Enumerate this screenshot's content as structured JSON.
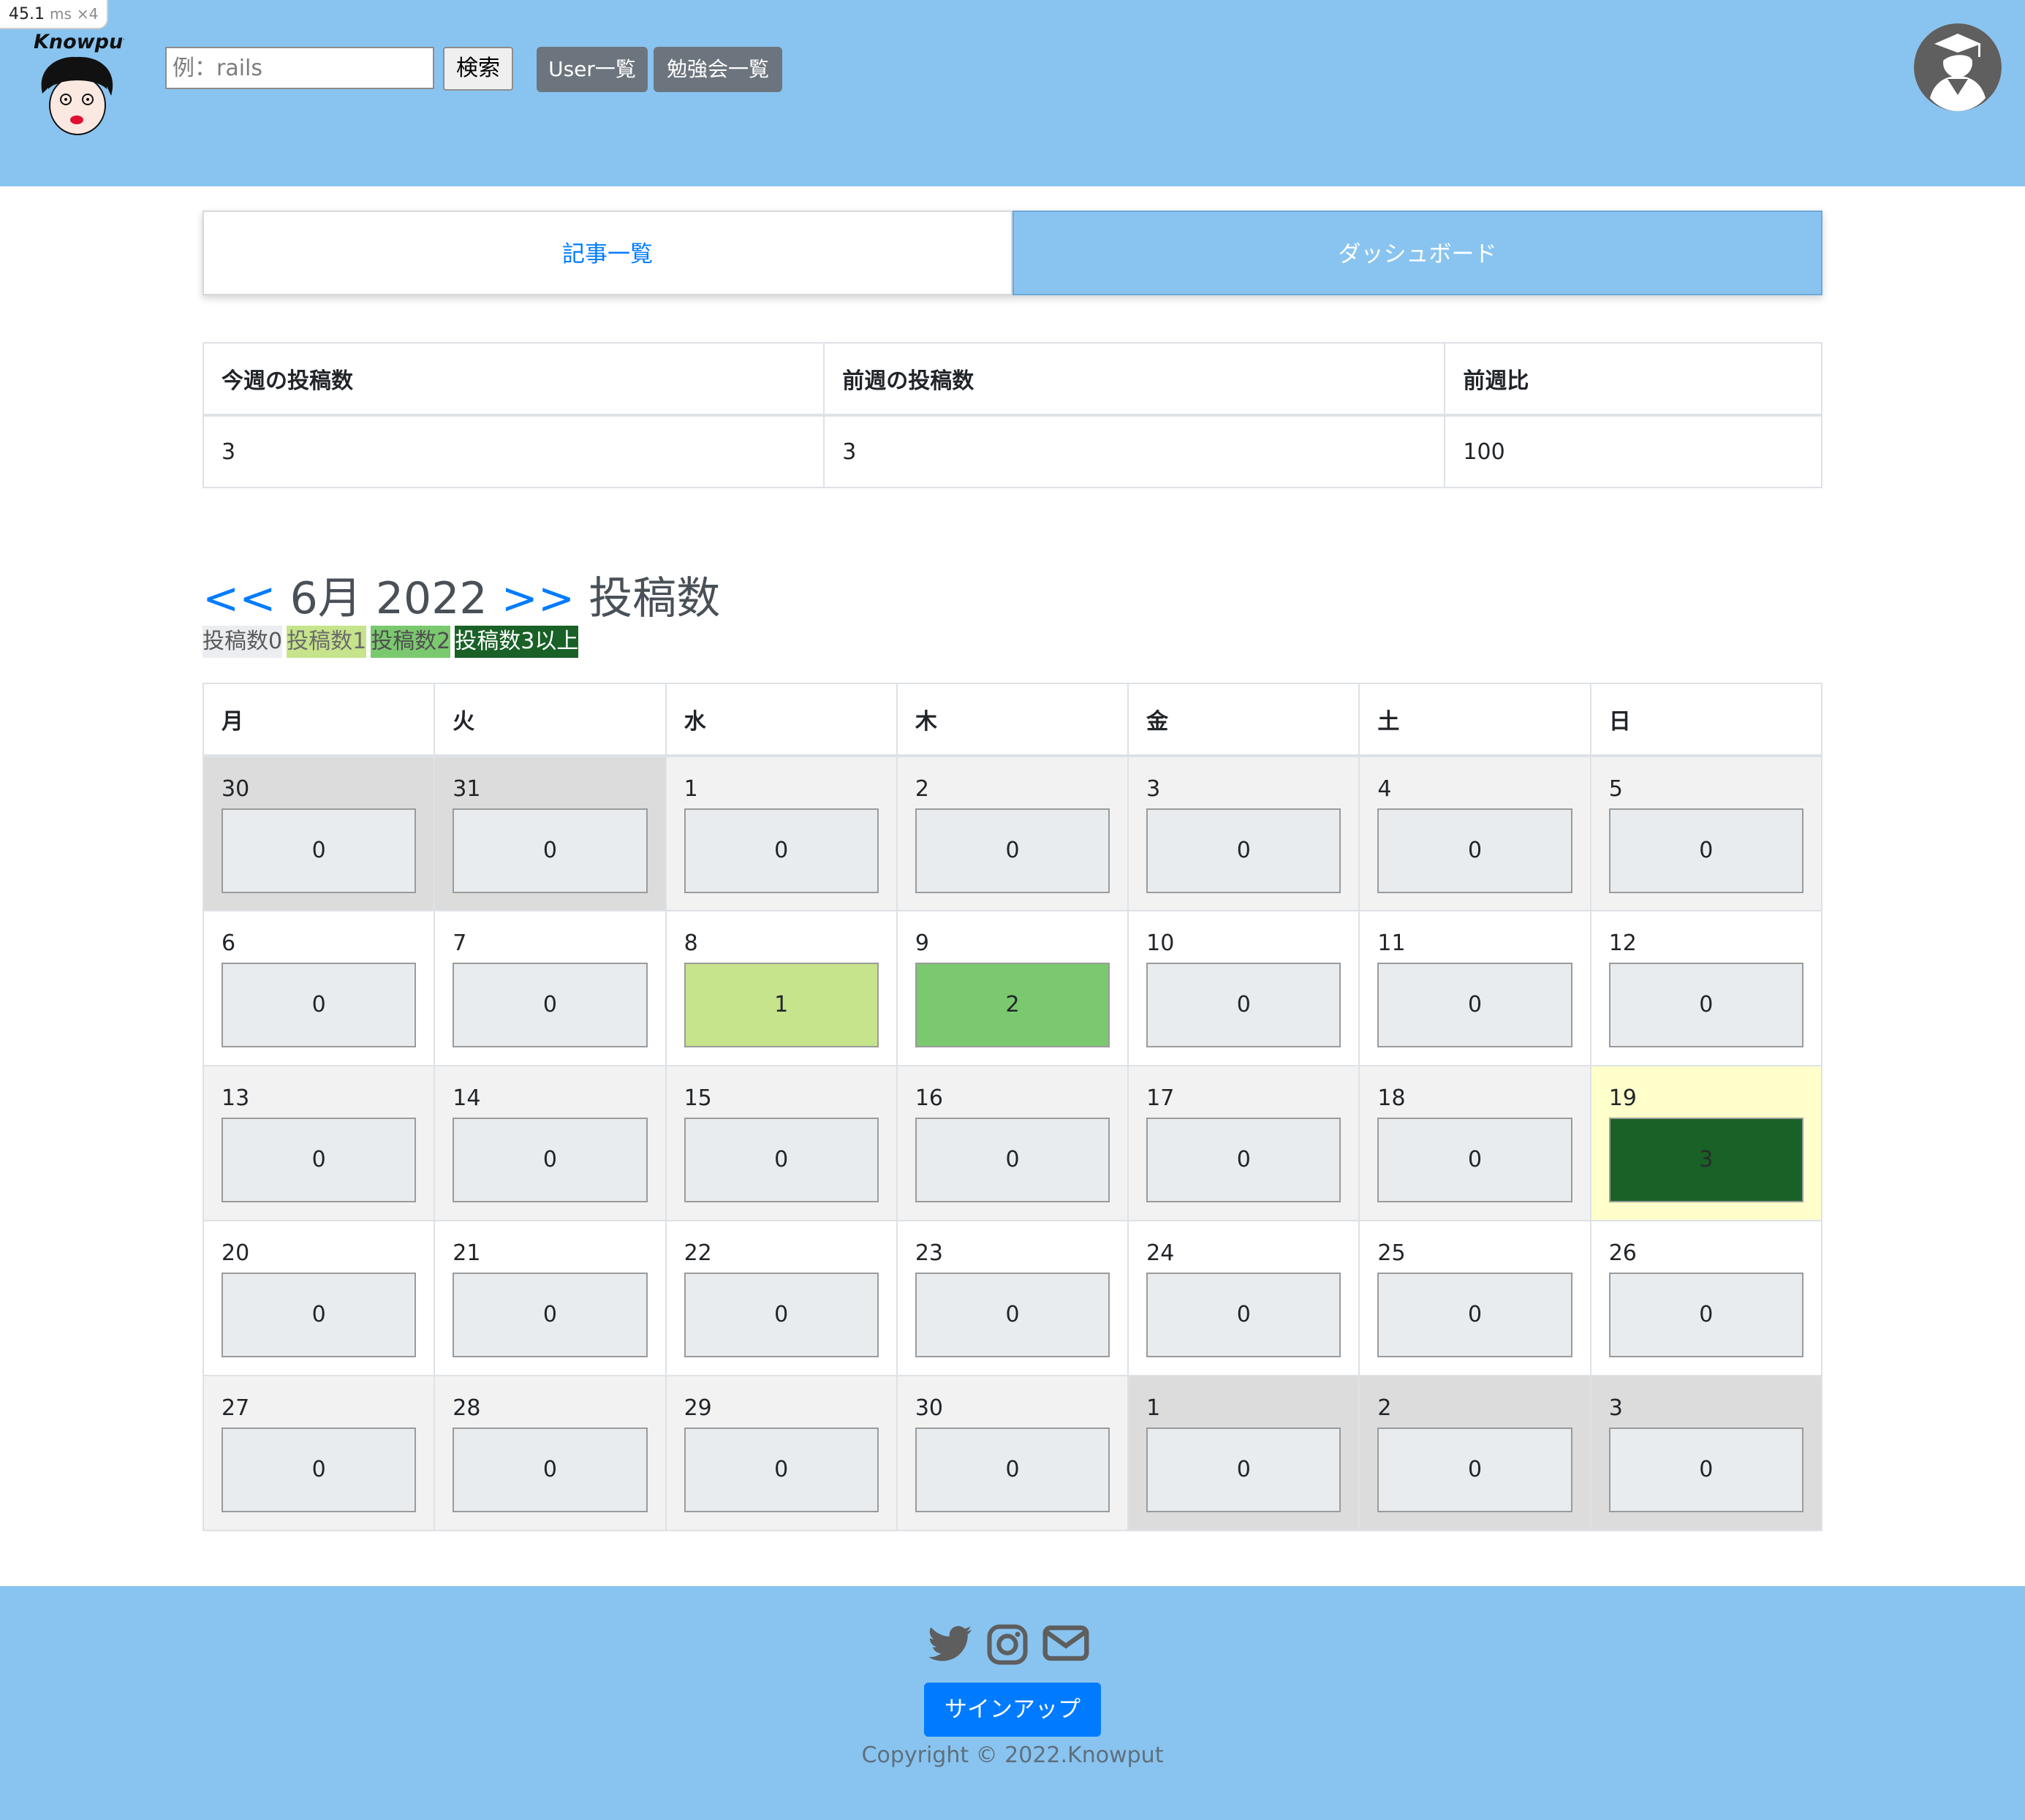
{
  "perf": {
    "value": "45.1",
    "unit": "ms",
    "mult": "×4"
  },
  "header": {
    "logo_text": "Knowput",
    "search_placeholder": "例：rails",
    "search_button": "検索",
    "nav": [
      "User一覧",
      "勉強会一覧"
    ]
  },
  "tabs": {
    "articles": "記事一覧",
    "dashboard": "ダッシュボード"
  },
  "stats": {
    "headers": [
      "今週の投稿数",
      "前週の投稿数",
      "前週比"
    ],
    "values": [
      "3",
      "3",
      "100"
    ]
  },
  "calendar": {
    "prev": "<<",
    "month": "6月 2022",
    "next": ">>",
    "label": "投稿数",
    "legend": [
      "投稿数0",
      "投稿数1",
      "投稿数2",
      "投稿数3以上"
    ],
    "weekdays": [
      "月",
      "火",
      "水",
      "木",
      "金",
      "土",
      "日"
    ],
    "weeks": [
      [
        {
          "d": "30",
          "c": "0",
          "o": true
        },
        {
          "d": "31",
          "c": "0",
          "o": true
        },
        {
          "d": "1",
          "c": "0"
        },
        {
          "d": "2",
          "c": "0"
        },
        {
          "d": "3",
          "c": "0"
        },
        {
          "d": "4",
          "c": "0"
        },
        {
          "d": "5",
          "c": "0"
        }
      ],
      [
        {
          "d": "6",
          "c": "0"
        },
        {
          "d": "7",
          "c": "0"
        },
        {
          "d": "8",
          "c": "1"
        },
        {
          "d": "9",
          "c": "2"
        },
        {
          "d": "10",
          "c": "0"
        },
        {
          "d": "11",
          "c": "0"
        },
        {
          "d": "12",
          "c": "0"
        }
      ],
      [
        {
          "d": "13",
          "c": "0"
        },
        {
          "d": "14",
          "c": "0"
        },
        {
          "d": "15",
          "c": "0"
        },
        {
          "d": "16",
          "c": "0"
        },
        {
          "d": "17",
          "c": "0"
        },
        {
          "d": "18",
          "c": "0"
        },
        {
          "d": "19",
          "c": "3",
          "t": true
        }
      ],
      [
        {
          "d": "20",
          "c": "0"
        },
        {
          "d": "21",
          "c": "0"
        },
        {
          "d": "22",
          "c": "0"
        },
        {
          "d": "23",
          "c": "0"
        },
        {
          "d": "24",
          "c": "0"
        },
        {
          "d": "25",
          "c": "0"
        },
        {
          "d": "26",
          "c": "0"
        }
      ],
      [
        {
          "d": "27",
          "c": "0"
        },
        {
          "d": "28",
          "c": "0"
        },
        {
          "d": "29",
          "c": "0"
        },
        {
          "d": "30",
          "c": "0"
        },
        {
          "d": "1",
          "c": "0",
          "o": true
        },
        {
          "d": "2",
          "c": "0",
          "o": true
        },
        {
          "d": "3",
          "c": "0",
          "o": true
        }
      ]
    ]
  },
  "footer": {
    "icons": [
      "twitter-icon",
      "instagram-icon",
      "mail-icon"
    ],
    "signup": "サインアップ",
    "copyright": "Copyright © 2022.Knowput"
  },
  "colors": {
    "header_bg": "#89c4f0",
    "link": "#007bff",
    "level0": "#ebedf0",
    "level1": "#c6e48b",
    "level2": "#7bc96f",
    "level3": "#196127",
    "today": "#ffffcc"
  }
}
